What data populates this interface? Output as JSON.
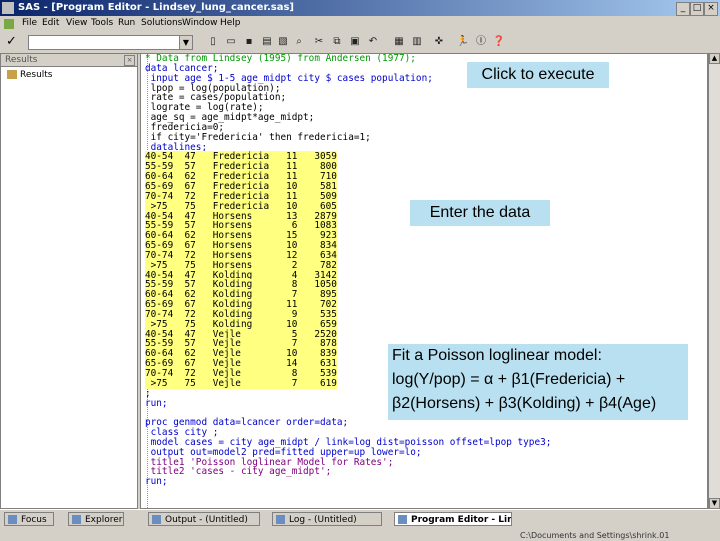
{
  "window": {
    "title": "SAS - [Program Editor - Lindsey_lung_cancer.sas]"
  },
  "menu": [
    "File",
    "Edit",
    "View",
    "Tools",
    "Run",
    "Solutions",
    "Window",
    "Help"
  ],
  "toolbar": {
    "command_value": "",
    "icons": [
      "new-icon",
      "open-icon",
      "save-icon",
      "print-icon",
      "print-preview-icon",
      "find-icon",
      "cut-icon",
      "copy-icon",
      "paste-icon",
      "undo-icon",
      "new-library-icon",
      "explorer-icon",
      "submit-icon",
      "help-icon"
    ]
  },
  "results_panel": {
    "header": "Results",
    "item": "Results"
  },
  "code_lines": [
    {
      "t": "c-com",
      "s": "* Data from Lindsey (1995) from Andersen (1977);"
    },
    {
      "t": "c-kw",
      "s": "data lcancer;"
    },
    {
      "t": "c-kw",
      "s": " input age $ 1-5 age_midpt city $ cases population;"
    },
    {
      "t": "c-txt",
      "s": " lpop = log(population);"
    },
    {
      "t": "c-txt",
      "s": " rate = cases/population;"
    },
    {
      "t": "c-txt",
      "s": " lograte = log(rate);"
    },
    {
      "t": "c-txt",
      "s": " age_sq = age_midpt*age_midpt;"
    },
    {
      "t": "c-txt",
      "s": " fredericia=0;"
    },
    {
      "t": "c-txt",
      "s": " if city='Fredericia' then fredericia=1;"
    },
    {
      "t": "c-kw",
      "s": " datalines;"
    },
    {
      "t": "c-data",
      "s": "40-54  47   Fredericia   11   3059"
    },
    {
      "t": "c-data",
      "s": "55-59  57   Fredericia   11    800"
    },
    {
      "t": "c-data",
      "s": "60-64  62   Fredericia   11    710"
    },
    {
      "t": "c-data",
      "s": "65-69  67   Fredericia   10    581"
    },
    {
      "t": "c-data",
      "s": "70-74  72   Fredericia   11    509"
    },
    {
      "t": "c-data",
      "s": " >75   75   Fredericia   10    605"
    },
    {
      "t": "c-data",
      "s": "40-54  47   Horsens      13   2879"
    },
    {
      "t": "c-data",
      "s": "55-59  57   Horsens       6   1083"
    },
    {
      "t": "c-data",
      "s": "60-64  62   Horsens      15    923"
    },
    {
      "t": "c-data",
      "s": "65-69  67   Horsens      10    834"
    },
    {
      "t": "c-data",
      "s": "70-74  72   Horsens      12    634"
    },
    {
      "t": "c-data",
      "s": " >75   75   Horsens       2    782"
    },
    {
      "t": "c-data",
      "s": "40-54  47   Kolding       4   3142"
    },
    {
      "t": "c-data",
      "s": "55-59  57   Kolding       8   1050"
    },
    {
      "t": "c-data",
      "s": "60-64  62   Kolding       7    895"
    },
    {
      "t": "c-data",
      "s": "65-69  67   Kolding      11    702"
    },
    {
      "t": "c-data",
      "s": "70-74  72   Kolding       9    535"
    },
    {
      "t": "c-data",
      "s": " >75   75   Kolding      10    659"
    },
    {
      "t": "c-data",
      "s": "40-54  47   Vejle         5   2520"
    },
    {
      "t": "c-data",
      "s": "55-59  57   Vejle         7    878"
    },
    {
      "t": "c-data",
      "s": "60-64  62   Vejle        10    839"
    },
    {
      "t": "c-data",
      "s": "65-69  67   Vejle        14    631"
    },
    {
      "t": "c-data",
      "s": "70-74  72   Vejle         8    539"
    },
    {
      "t": "c-data",
      "s": " >75   75   Vejle         7    619"
    },
    {
      "t": "c-txt",
      "s": ";"
    },
    {
      "t": "c-kw",
      "s": "run;"
    },
    {
      "t": "c-txt",
      "s": ""
    },
    {
      "t": "c-kw",
      "s": "proc genmod data=lcancer order=data;"
    },
    {
      "t": "c-kw",
      "s": " class city ;"
    },
    {
      "t": "c-kw",
      "s": " model cases = city age_midpt / link=log dist=poisson offset=lpop type3;"
    },
    {
      "t": "c-kw",
      "s": " output out=model2 pred=fitted upper=up lower=lo;"
    },
    {
      "t": "c-str",
      "s": " title1 'Poisson loglinear Model for Rates';"
    },
    {
      "t": "c-str",
      "s": " title2 'cases - city age_midpt';"
    },
    {
      "t": "c-kw",
      "s": "run;"
    }
  ],
  "callouts": {
    "execute": "Click to execute",
    "data": "Enter the data",
    "model_line1": "Fit a Poisson loglinear model:",
    "model_line2": "log(Y/pop) = α + β1(Fredericia) +",
    "model_line3": "β2(Horsens) + β3(Kolding) + β4(Age)"
  },
  "status": {
    "tabs": [
      "Focus",
      "Explorer",
      "Output - (Untitled)",
      "Log - (Untitled)",
      "Program Editor - Lindsey..."
    ],
    "path": "C:\\Documents and Settings\\shrink.01"
  }
}
